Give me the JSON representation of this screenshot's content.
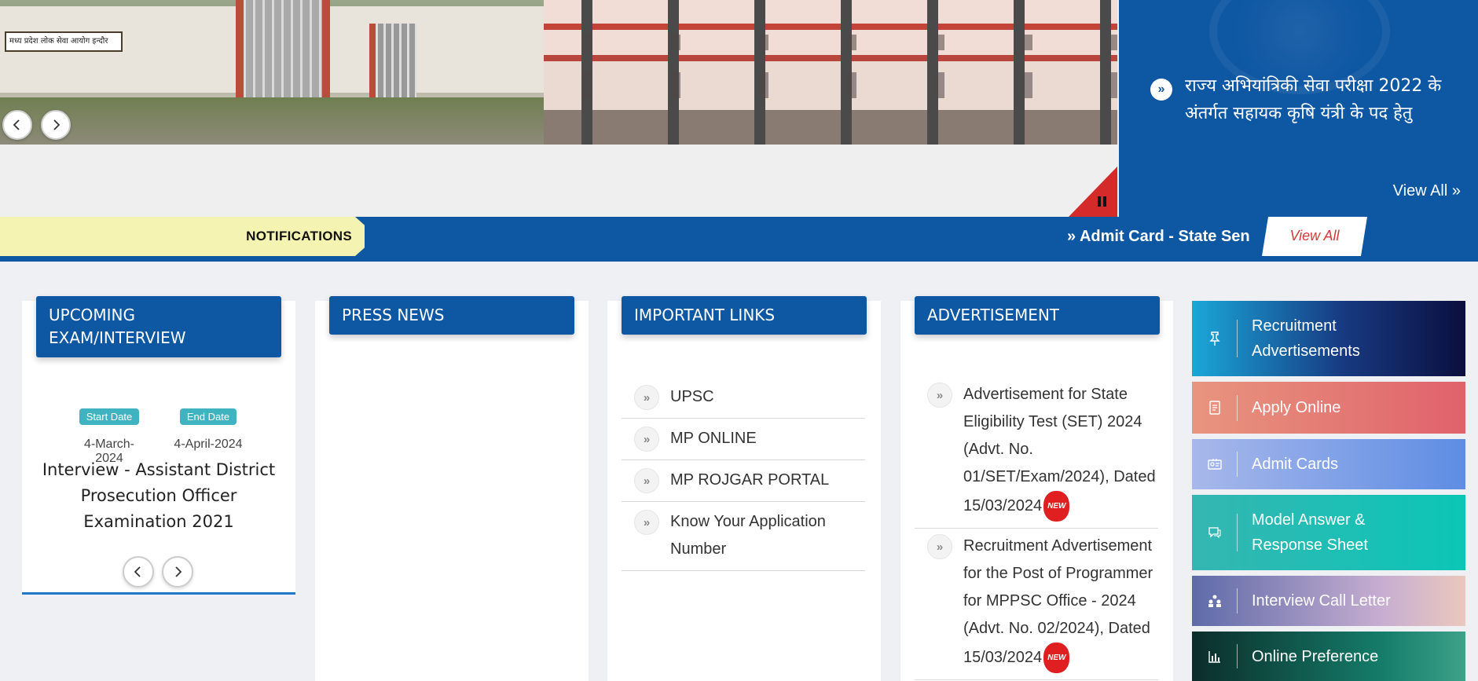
{
  "hero": {
    "sign_text": "मध्य प्रदेश लोक सेवा आयोग इन्दौर",
    "news": {
      "text": "राज्य अभियांत्रिकी सेवा परीक्षा 2022 के अंतर्गत सहायक कृषि यंत्री के पद हेतु",
      "view_all": "View All »"
    }
  },
  "notifications": {
    "label": "NOTIFICATIONS",
    "ticker": "» Admit Card - State Sen",
    "view_all": "View All"
  },
  "upcoming": {
    "title": "UPCOMING EXAM/INTERVIEW",
    "start_label": "Start Date",
    "end_label": "End Date",
    "start_date": "4-March-2024",
    "end_date": "4-April-2024",
    "exam_title": "Interview - Assistant District Prosecution Officer Examination 2021"
  },
  "press": {
    "title": "PRESS NEWS"
  },
  "links": {
    "title": "IMPORTANT LINKS",
    "items": [
      {
        "label": "UPSC"
      },
      {
        "label": "MP ONLINE"
      },
      {
        "label": "MP ROJGAR PORTAL"
      },
      {
        "label": "Know Your Application Number"
      }
    ]
  },
  "ads": {
    "title": "ADVERTISEMENT",
    "new_label": "NEW",
    "items": [
      {
        "label": "Advertisement for State Eligibility Test (SET) 2024 (Advt. No. 01/SET/Exam/2024), Dated 15/03/2024"
      },
      {
        "label": "Recruitment Advertisement for the Post of Programmer for MPPSC Office - 2024 (Advt. No. 02/2024), Dated 15/03/2024"
      }
    ]
  },
  "quick_links": [
    {
      "label": "Recruitment Advertisements",
      "icon": "pin-icon"
    },
    {
      "label": "Apply Online",
      "icon": "form-icon"
    },
    {
      "label": "Admit Cards",
      "icon": "id-card-icon"
    },
    {
      "label": "Model Answer & Response Sheet",
      "icon": "chat-icon"
    },
    {
      "label": "Interview Call Letter",
      "icon": "people-icon"
    },
    {
      "label": "Online Preference",
      "icon": "bar-chart-icon"
    }
  ],
  "colors": {
    "primary": "#0e57a3",
    "notif_label_bg": "#f5f3b1",
    "view_all_text": "#d33b3b",
    "badge": "#3fb3c0"
  }
}
